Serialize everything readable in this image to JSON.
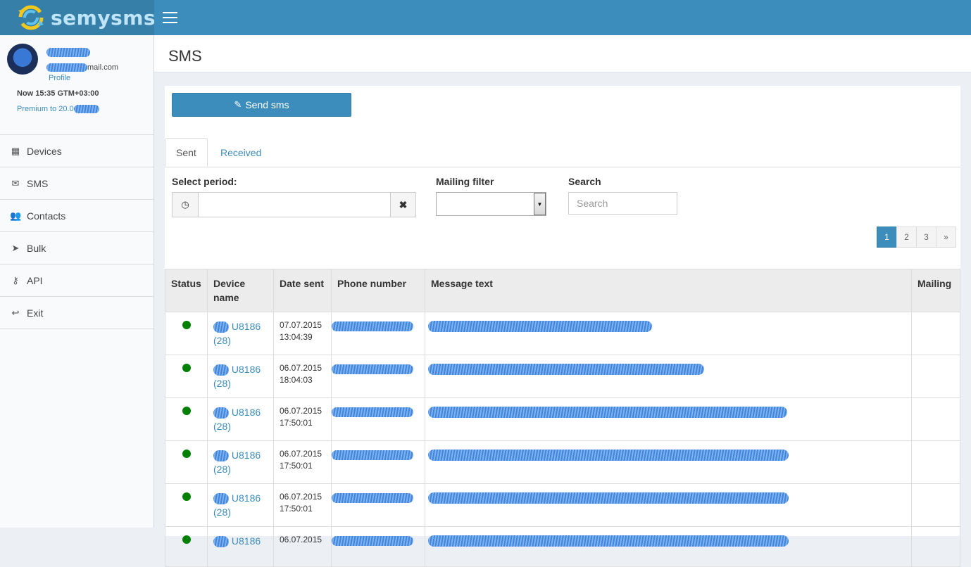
{
  "brand": {
    "name": "semysms",
    "colors": {
      "header": "#3c8dbc",
      "logo_bg": "#367fa9",
      "accent": "#3c8dbc",
      "status_ok": "#008000"
    }
  },
  "header": {
    "menu_icon": "hamburger-icon"
  },
  "user": {
    "email_suffix": "mail.com",
    "profile_label": "Profile",
    "now_text": "Now 15:35 GTM+03:00",
    "premium_text": "Premium to 20.0"
  },
  "sidebar": {
    "items": [
      {
        "label": "Devices",
        "icon": "grid-icon"
      },
      {
        "label": "SMS",
        "icon": "envelope-icon"
      },
      {
        "label": "Contacts",
        "icon": "users-icon"
      },
      {
        "label": "Bulk",
        "icon": "send-icon"
      },
      {
        "label": "API",
        "icon": "key-icon"
      },
      {
        "label": "Exit",
        "icon": "reply-icon"
      }
    ]
  },
  "page": {
    "title": "SMS"
  },
  "actions": {
    "send_label": "Send sms"
  },
  "tabs": [
    {
      "label": "Sent"
    },
    {
      "label": "Received"
    }
  ],
  "filters": {
    "period_label": "Select period:",
    "mailing_label": "Mailing filter",
    "search_label": "Search",
    "search_placeholder": "Search"
  },
  "pagination": {
    "pages": [
      "1",
      "2",
      "3"
    ],
    "next": "»",
    "current": "1"
  },
  "table": {
    "columns": [
      "Status",
      "Device name",
      "Date sent",
      "Phone number",
      "Message text",
      "Mailing"
    ],
    "rows": [
      {
        "device": "U8186",
        "count": "(28)",
        "date": "07.07.2015",
        "time": "13:04:39"
      },
      {
        "device": "U8186",
        "count": "(28)",
        "date": "06.07.2015",
        "time": "18:04:03"
      },
      {
        "device": "U8186",
        "count": "(28)",
        "date": "06.07.2015",
        "time": "17:50:01"
      },
      {
        "device": "U8186",
        "count": "(28)",
        "date": "06.07.2015",
        "time": "17:50:01"
      },
      {
        "device": "U8186",
        "count": "(28)",
        "date": "06.07.2015",
        "time": "17:50:01"
      },
      {
        "device": "U8186",
        "count": "",
        "date": "06.07.2015",
        "time": ""
      }
    ]
  }
}
